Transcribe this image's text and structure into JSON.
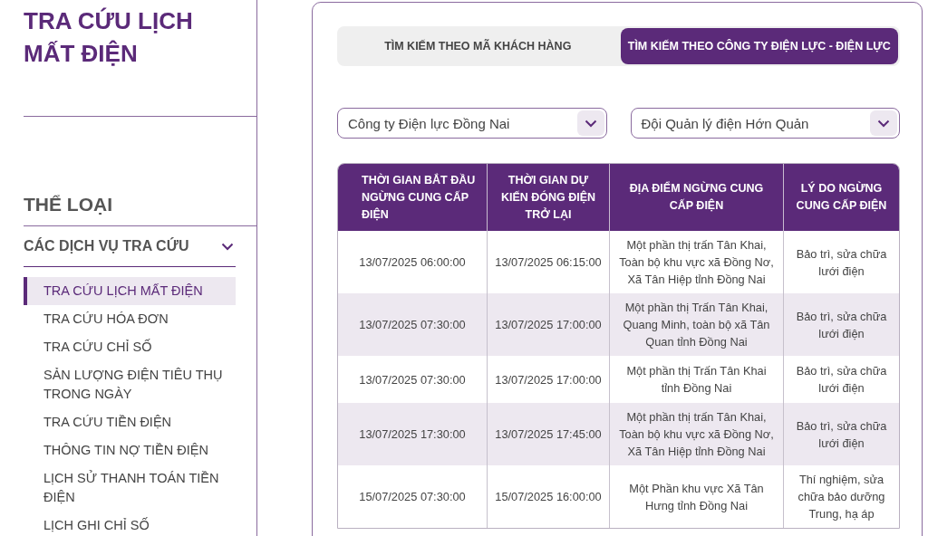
{
  "sidebar": {
    "title": "TRA CỨU LỊCH MẤT ĐIỆN",
    "category_heading": "THỂ LOẠI",
    "group": {
      "label": "CÁC DỊCH VỤ TRA CỨU",
      "expanded": true
    },
    "items": [
      {
        "label": "TRA CỨU LỊCH MẤT ĐIỆN",
        "selected": true
      },
      {
        "label": "TRA CỨU HÓA ĐƠN",
        "selected": false
      },
      {
        "label": "TRA CỨU CHỈ SỐ",
        "selected": false
      },
      {
        "label": "SẢN LƯỢNG ĐIỆN TIÊU THỤ TRONG NGÀY",
        "selected": false
      },
      {
        "label": "TRA CỨU TIỀN ĐIỆN",
        "selected": false
      },
      {
        "label": "THÔNG TIN NỢ TIỀN ĐIỆN",
        "selected": false
      },
      {
        "label": "LỊCH SỬ THANH TOÁN TIỀN ĐIỆN",
        "selected": false
      },
      {
        "label": "LỊCH GHI CHỈ SỐ",
        "selected": false
      }
    ]
  },
  "tabs": [
    {
      "label": "TÌM KIẾM THEO MÃ KHÁCH HÀNG",
      "selected": false
    },
    {
      "label": "TÌM KIẾM THEO CÔNG TY ĐIỆN LỰC - ĐIỆN LỰC",
      "selected": true
    }
  ],
  "filters": [
    {
      "value": "Công ty Điện lực Đồng Nai"
    },
    {
      "value": "Đội Quản lý điện Hớn Quản"
    }
  ],
  "table": {
    "columns": [
      "THỜI GIAN BẮT ĐẦU NGỪNG CUNG CẤP ĐIỆN",
      "THỜI GIAN DỰ KIẾN ĐÓNG ĐIỆN TRỞ LẠI",
      "ĐỊA ĐIỂM NGỪNG CUNG CẤP ĐIỆN",
      "LÝ DO NGỪNG CUNG CẤP ĐIỆN"
    ],
    "rows": [
      [
        "13/07/2025 06:00:00",
        "13/07/2025 06:15:00",
        "Một phần thị trấn Tân Khai, Toàn bộ khu vực xã Đồng Nơ, Xã Tân Hiệp tỉnh Đồng Nai",
        "Bảo trì, sửa chữa lưới điện"
      ],
      [
        "13/07/2025 07:30:00",
        "13/07/2025 17:00:00",
        "Một phần thị Trấn Tân Khai, Quang Minh, toàn bộ xã Tân Quan tỉnh Đồng Nai",
        "Bảo trì, sửa chữa lưới điện"
      ],
      [
        "13/07/2025 07:30:00",
        "13/07/2025 17:00:00",
        "Một phần thị Trấn Tân Khai tỉnh Đồng Nai",
        "Bảo trì, sửa chữa lưới điện"
      ],
      [
        "13/07/2025 17:30:00",
        "13/07/2025 17:45:00",
        "Một phần thị trấn Tân Khai, Toàn bộ khu vực xã Đồng Nơ, Xã Tân Hiệp tỉnh Đồng Nai",
        "Bảo trì, sửa chữa lưới điện"
      ],
      [
        "15/07/2025 07:30:00",
        "15/07/2025 16:00:00",
        "Một Phần khu vực Xã Tân Hưng tỉnh Đồng Nai",
        "Thí nghiệm, sửa chữa bảo dưỡng Trung, hạ áp"
      ]
    ]
  }
}
